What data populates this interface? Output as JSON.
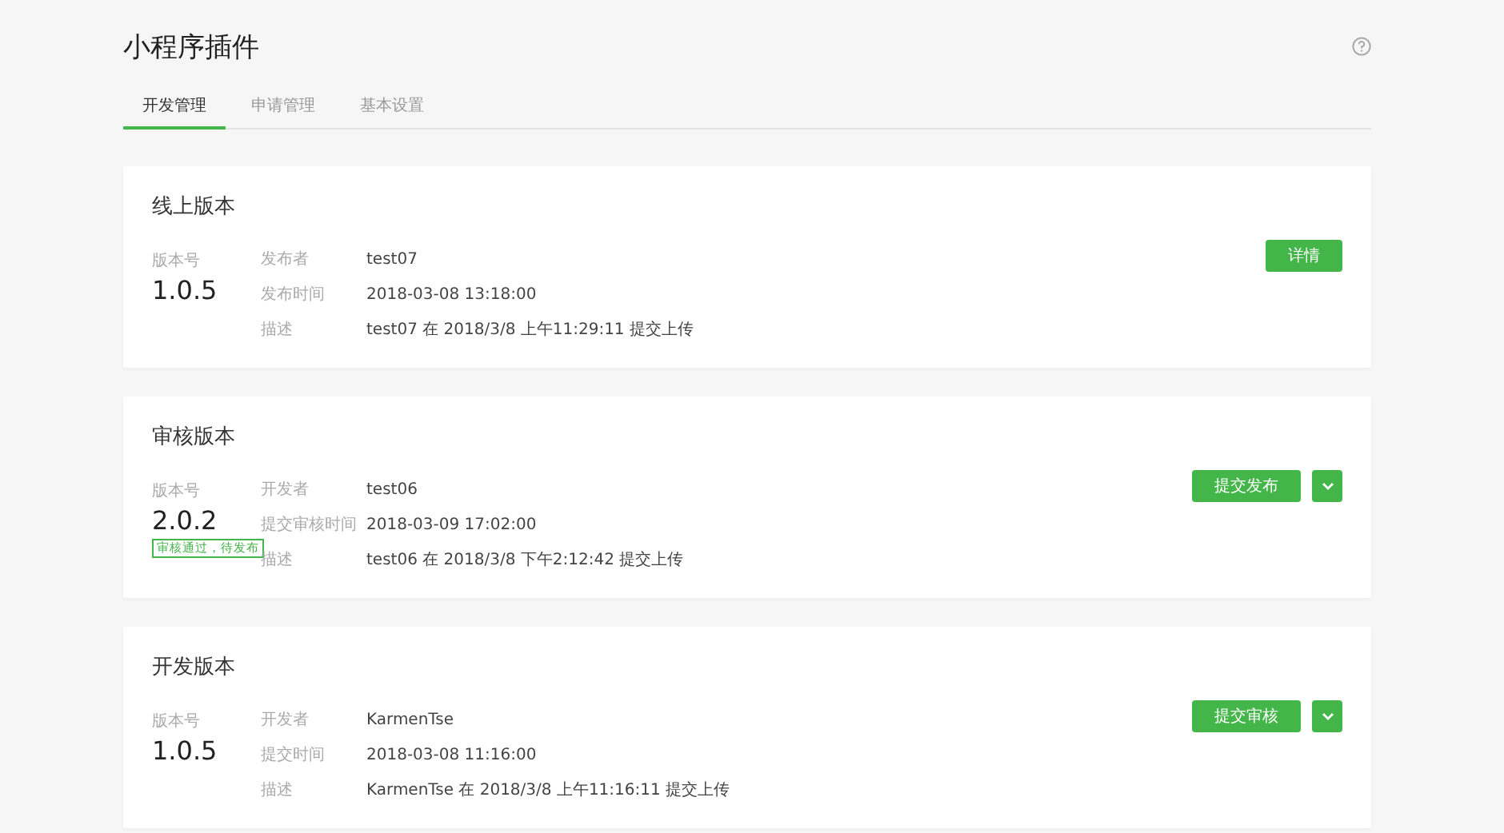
{
  "page": {
    "title": "小程序插件"
  },
  "tabs": [
    {
      "label": "开发管理",
      "selected": true
    },
    {
      "label": "申请管理",
      "selected": false
    },
    {
      "label": "基本设置",
      "selected": false
    }
  ],
  "cards": [
    {
      "title": "线上版本",
      "version_label": "版本号",
      "version": "1.0.5",
      "fields": [
        {
          "label": "发布者",
          "value": "test07"
        },
        {
          "label": "发布时间",
          "value": "2018-03-08 13:18:00"
        },
        {
          "label": "描述",
          "value": "test07 在 2018/3/8 上午11:29:11 提交上传"
        }
      ],
      "buttons": [
        {
          "kind": "primary",
          "label": "详情"
        }
      ]
    },
    {
      "title": "审核版本",
      "version_label": "版本号",
      "version": "2.0.2",
      "status": "审核通过，待发布",
      "fields": [
        {
          "label": "开发者",
          "value": "test06"
        },
        {
          "label": "提交审核时间",
          "value": "2018-03-09 17:02:00"
        },
        {
          "label": "描述",
          "value": "test06 在 2018/3/8 下午2:12:42 提交上传"
        }
      ],
      "buttons": [
        {
          "kind": "primary",
          "label": "提交发布"
        },
        {
          "kind": "dropdown"
        }
      ]
    },
    {
      "title": "开发版本",
      "version_label": "版本号",
      "version": "1.0.5",
      "fields": [
        {
          "label": "开发者",
          "value": "KarmenTse"
        },
        {
          "label": "提交时间",
          "value": "2018-03-08 11:16:00"
        },
        {
          "label": "描述",
          "value": "KarmenTse 在 2018/3/8 上午11:16:11 提交上传"
        }
      ],
      "buttons": [
        {
          "kind": "primary",
          "label": "提交审核"
        },
        {
          "kind": "dropdown"
        }
      ]
    }
  ]
}
